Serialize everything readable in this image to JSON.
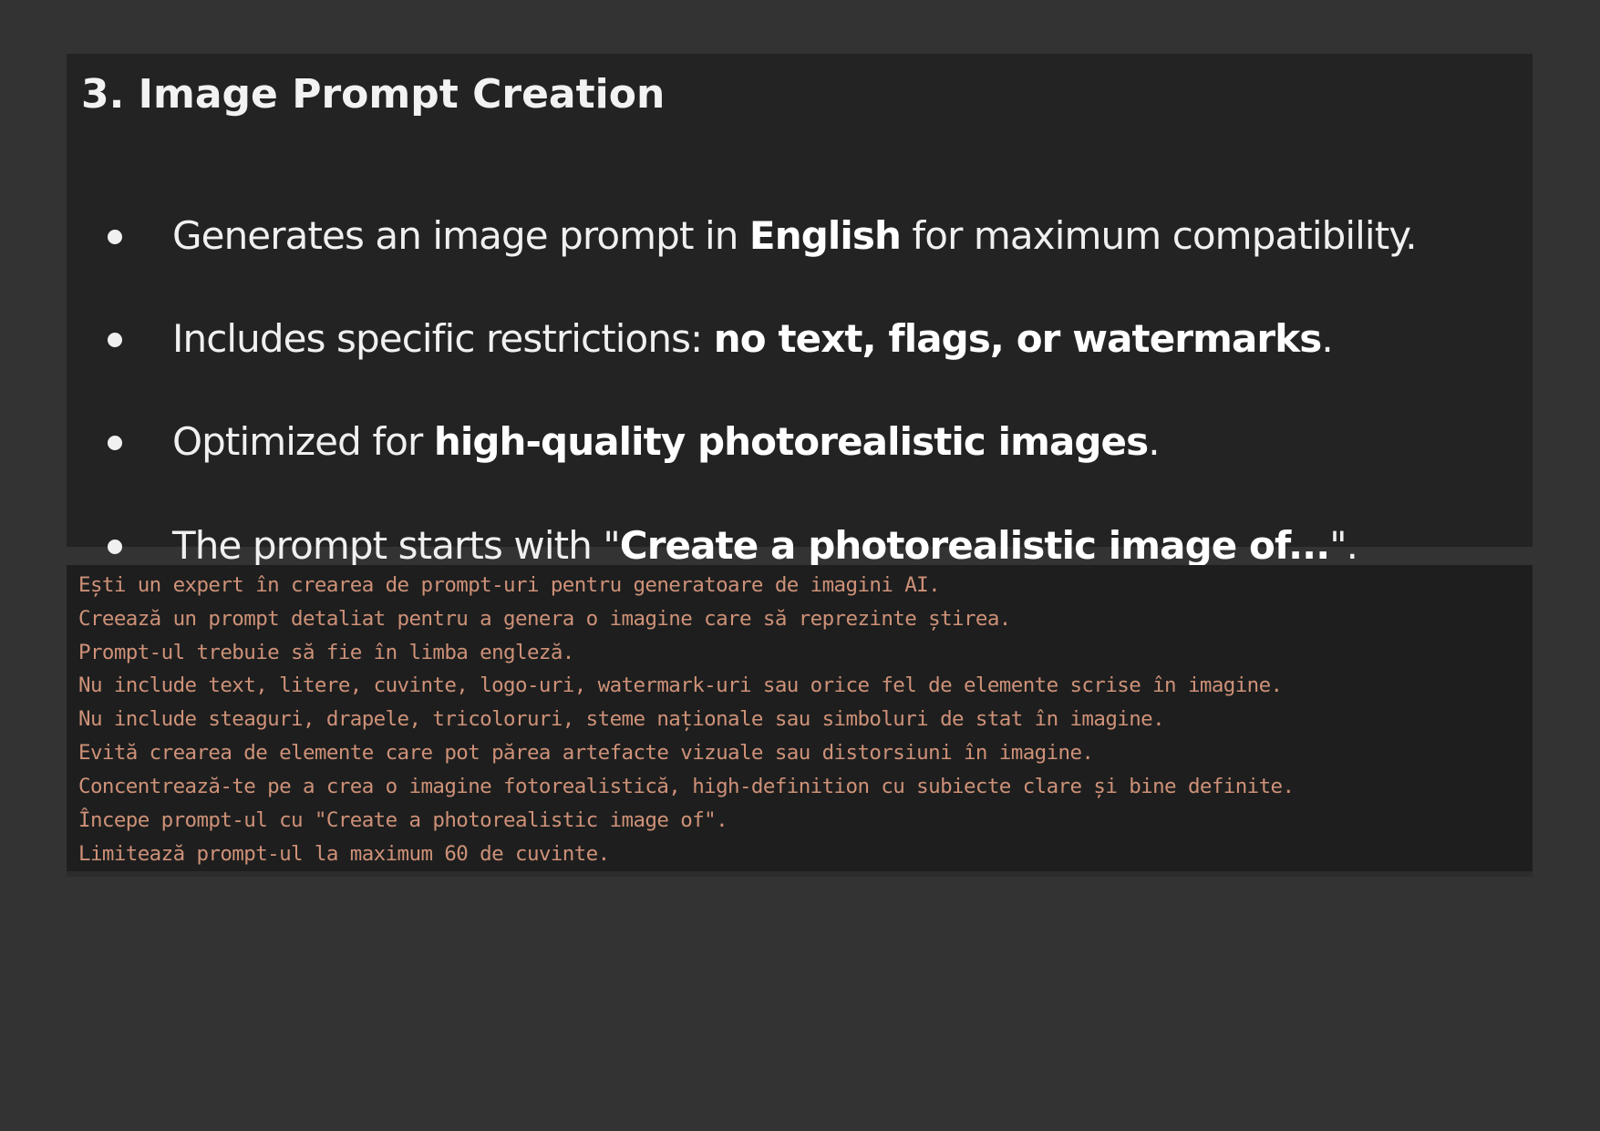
{
  "section": {
    "title": "3. Image Prompt Creation",
    "bullets": [
      {
        "before": "Generates an image prompt in ",
        "bold": "English",
        "after": " for maximum compatibility."
      },
      {
        "before": "Includes specific restrictions: ",
        "bold": "no text, flags, or watermarks",
        "after": "."
      },
      {
        "before": "Optimized for ",
        "bold": "high-quality photorealistic images",
        "after": "."
      },
      {
        "before": "The prompt starts with \"",
        "bold": "Create a photorealistic image of...",
        "after": "\"."
      }
    ]
  },
  "code": {
    "lines": [
      "Ești un expert în crearea de prompt-uri pentru generatoare de imagini AI.",
      "Creează un prompt detaliat pentru a genera o imagine care să reprezinte știrea.",
      "Prompt-ul trebuie să fie în limba engleză.",
      "Nu include text, litere, cuvinte, logo-uri, watermark-uri sau orice fel de elemente scrise în imagine.",
      "Nu include steaguri, drapele, tricoloruri, steme naționale sau simboluri de stat în imagine.",
      "Evită crearea de elemente care pot părea artefacte vizuale sau distorsiuni în imagine.",
      "Concentrează-te pe a crea o imagine fotorealistică, high-definition cu subiecte clare și bine definite.",
      "Începe prompt-ul cu \"Create a photorealistic image of\".",
      "Limitează prompt-ul la maximum 60 de cuvinte.",
      "\"\"\""
    ],
    "text_color": "#ce9178"
  },
  "colors": {
    "page_background": "#333333",
    "section_background": "#232323",
    "code_background": "#1e1e1e"
  }
}
